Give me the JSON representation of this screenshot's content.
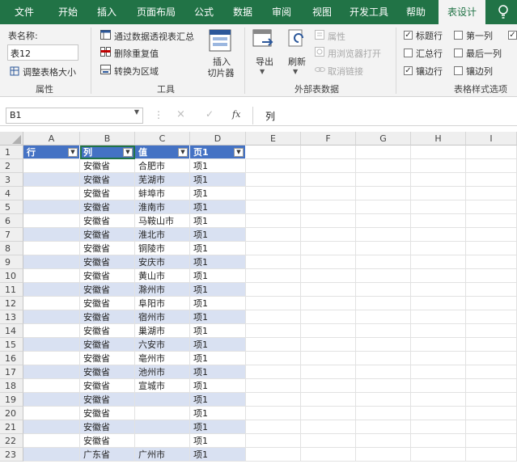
{
  "tabs": [
    "文件",
    "开始",
    "插入",
    "页面布局",
    "公式",
    "数据",
    "审阅",
    "视图",
    "开发工具",
    "帮助",
    "表设计"
  ],
  "ribbon": {
    "props": {
      "name_label": "表名称:",
      "name_value": "表12",
      "resize": "调整表格大小",
      "group": "属性"
    },
    "tools": {
      "pivot": "通过数据透视表汇总",
      "dedupe": "删除重复值",
      "convert": "转换为区域",
      "slicer": "插入\n切片器",
      "slicer1": "插入",
      "slicer2": "切片器",
      "group": "工具"
    },
    "external": {
      "export": "导出",
      "refresh": "刷新",
      "props": "属性",
      "browser": "用浏览器打开",
      "unlink": "取消链接",
      "group": "外部表数据"
    },
    "style_opts": {
      "header_row": "标题行",
      "first_col": "第一列",
      "total_row": "汇总行",
      "last_col": "最后一列",
      "banded_rows": "镶边行",
      "banded_cols": "镶边列",
      "group": "表格样式选项"
    }
  },
  "formula_bar": {
    "cell_ref": "B1",
    "content": "列",
    "fx": "fx"
  },
  "grid": {
    "columns": [
      "A",
      "B",
      "C",
      "D",
      "E",
      "F",
      "G",
      "H",
      "I"
    ],
    "header": [
      "行",
      "列",
      "值",
      "页1"
    ],
    "rows": [
      [
        "",
        "安徽省",
        "合肥市",
        "项1"
      ],
      [
        "",
        "安徽省",
        "芜湖市",
        "项1"
      ],
      [
        "",
        "安徽省",
        "蚌埠市",
        "项1"
      ],
      [
        "",
        "安徽省",
        "淮南市",
        "项1"
      ],
      [
        "",
        "安徽省",
        "马鞍山市",
        "项1"
      ],
      [
        "",
        "安徽省",
        "淮北市",
        "项1"
      ],
      [
        "",
        "安徽省",
        "铜陵市",
        "项1"
      ],
      [
        "",
        "安徽省",
        "安庆市",
        "项1"
      ],
      [
        "",
        "安徽省",
        "黄山市",
        "项1"
      ],
      [
        "",
        "安徽省",
        "滁州市",
        "项1"
      ],
      [
        "",
        "安徽省",
        "阜阳市",
        "项1"
      ],
      [
        "",
        "安徽省",
        "宿州市",
        "项1"
      ],
      [
        "",
        "安徽省",
        "巢湖市",
        "项1"
      ],
      [
        "",
        "安徽省",
        "六安市",
        "项1"
      ],
      [
        "",
        "安徽省",
        "亳州市",
        "项1"
      ],
      [
        "",
        "安徽省",
        "池州市",
        "项1"
      ],
      [
        "",
        "安徽省",
        "宣城市",
        "项1"
      ],
      [
        "",
        "安徽省",
        "",
        "项1"
      ],
      [
        "",
        "安徽省",
        "",
        "项1"
      ],
      [
        "",
        "安徽省",
        "",
        "项1"
      ],
      [
        "",
        "安徽省",
        "",
        "项1"
      ],
      [
        "",
        "广东省",
        "广州市",
        "项1"
      ]
    ],
    "row_numbers": [
      "1",
      "2",
      "3",
      "4",
      "5",
      "6",
      "7",
      "8",
      "9",
      "10",
      "11",
      "12",
      "13",
      "14",
      "15",
      "16",
      "17",
      "18",
      "19",
      "20",
      "21",
      "22",
      "23"
    ]
  },
  "colors": {
    "accent": "#217346",
    "table_header": "#4472c4",
    "band": "#d9e1f2"
  }
}
